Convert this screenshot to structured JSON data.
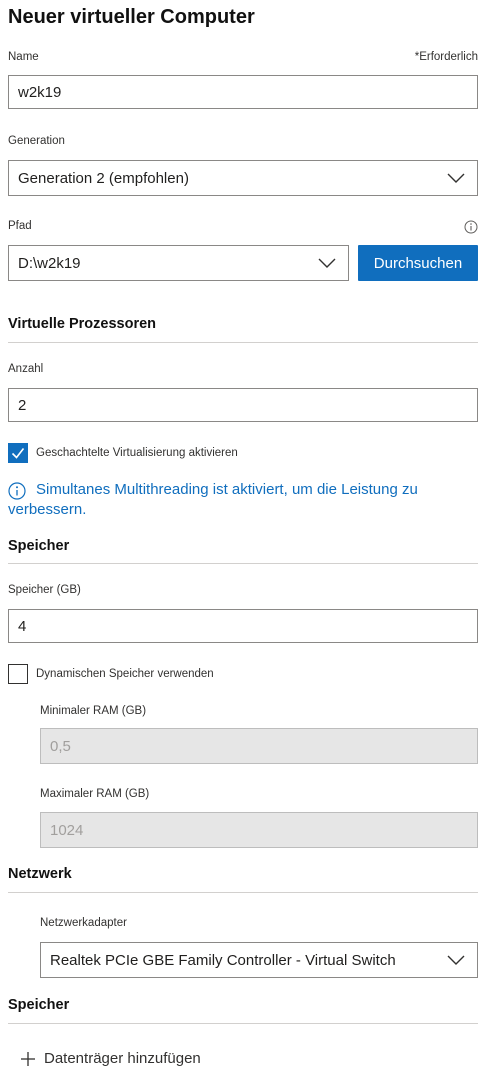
{
  "header": {
    "title": "Neuer virtueller Computer"
  },
  "name": {
    "label": "Name",
    "required": "*Erforderlich",
    "value": "w2k19"
  },
  "generation": {
    "label": "Generation",
    "value": "Generation 2 (empfohlen)"
  },
  "path": {
    "label": "Pfad",
    "value": "D:\\w2k19",
    "browse_label": "Durchsuchen"
  },
  "processors": {
    "section_title": "Virtuelle Prozessoren",
    "count_label": "Anzahl",
    "count_value": "2",
    "nested_label": "Geschachtelte Virtualisierung aktivieren",
    "nested_checked": true,
    "info_text_line1": "Simultanes Multithreading ist aktiviert, um die Leistung zu",
    "info_text_line2": "verbessern."
  },
  "memory": {
    "section_title": "Speicher",
    "size_label": "Speicher (GB)",
    "size_value": "4",
    "dynamic_label": "Dynamischen Speicher verwenden",
    "dynamic_checked": false,
    "min_label": "Minimaler RAM (GB)",
    "min_value": "0,5",
    "max_label": "Maximaler RAM (GB)",
    "max_value": "1024"
  },
  "network": {
    "section_title": "Netzwerk",
    "adapter_label": "Netzwerkadapter",
    "adapter_value": "Realtek PCIe GBE Family Controller - Virtual Switch"
  },
  "storage": {
    "section_title": "Speicher",
    "add_disk_label": "Datenträger hinzufügen"
  },
  "colors": {
    "accent": "#106ebe",
    "disabled_bg": "#e6e6e6"
  },
  "icons": {
    "chevron": "chevron-down-icon",
    "info": "info-icon",
    "check": "checkmark-icon",
    "add": "plus-icon"
  }
}
